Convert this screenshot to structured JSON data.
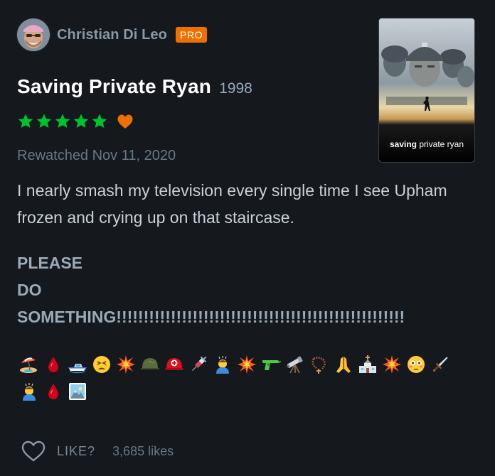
{
  "review": {
    "author": "Christian Di Leo",
    "badge": "PRO",
    "film_title": "Saving Private Ryan",
    "film_year": "1998",
    "rating_stars": 5,
    "liked": true,
    "rewatched": "Rewatched Nov 11, 2020",
    "body": "I nearly smash my television every single time I see Upham frozen and crying up on that staircase.",
    "shout_lines": [
      "PLEASE",
      "DO",
      "SOMETHING!!!!!!!!!!!!!!!!!!!!!!!!!!!!!!!!!!!!!!!!!!!!!!!!!!!!!"
    ],
    "emoji_icons": [
      "beach-umbrella-icon",
      "drop-of-blood-icon",
      "speedboat-icon",
      "tired-face-icon",
      "collision-icon",
      "military-helmet-icon",
      "rescue-worker-helmet-icon",
      "syringe-icon",
      "person-bowing-icon",
      "collision-icon",
      "water-pistol-icon",
      "telescope-icon",
      "prayer-beads-icon",
      "folded-hands-icon",
      "church-icon",
      "collision-icon",
      "flushed-face-icon",
      "dagger-icon",
      "person-bowing-icon",
      "drop-of-blood-icon",
      "sunrise-over-mountains-icon"
    ]
  },
  "poster": {
    "caption_bold": "saving",
    "caption_rest": " private ryan"
  },
  "likes": {
    "label": "LIKE?",
    "count": "3,685 likes"
  },
  "colors": {
    "background": "#15181c",
    "star": "#00c030",
    "heart": "#ee7000",
    "badge": "#ee7000"
  }
}
